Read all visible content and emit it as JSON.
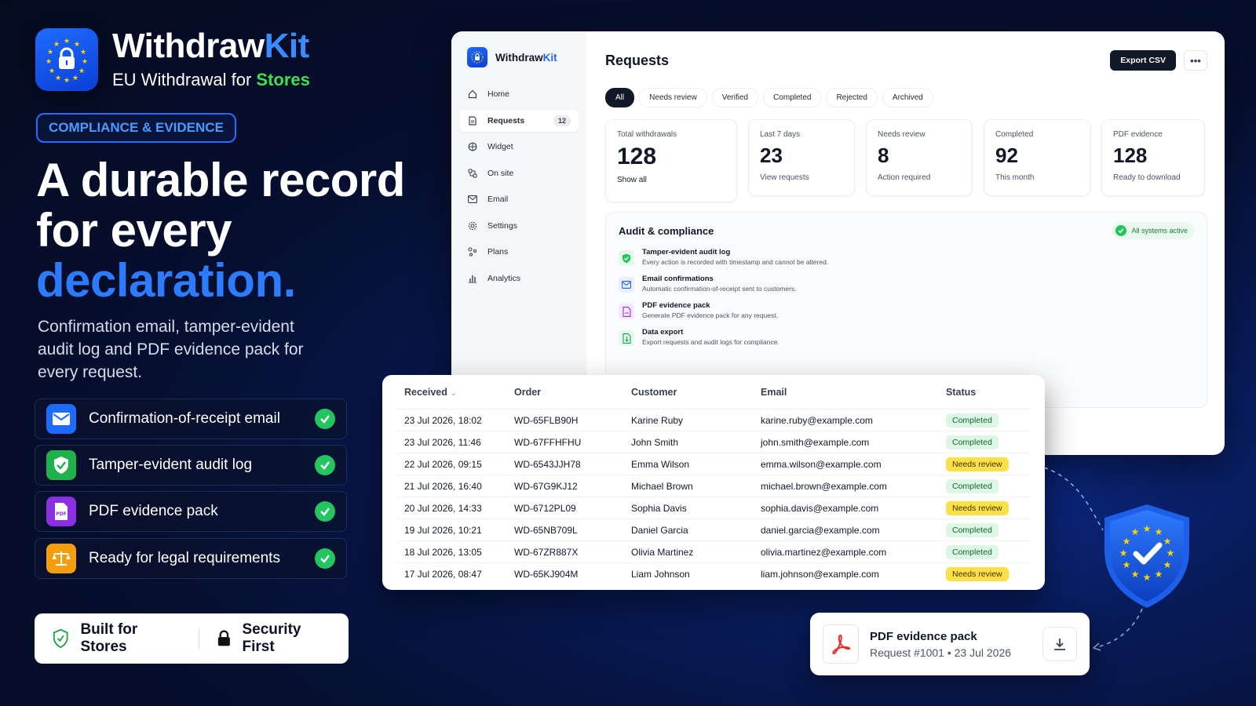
{
  "brand": {
    "name_main": "Withdraw",
    "name_accent": "Kit",
    "subtitle_main": "EU Withdrawal for ",
    "subtitle_accent": "Stores"
  },
  "marketing": {
    "badge": "COMPLIANCE & EVIDENCE",
    "headline_line1": "A durable record",
    "headline_line2": "for every",
    "headline_line3": "declaration.",
    "sub_copy": "Confirmation email, tamper-evident audit log and PDF evidence pack for every request.",
    "features": [
      {
        "label": "Confirmation-of-receipt email",
        "icon": "mail-icon"
      },
      {
        "label": "Tamper-evident audit log",
        "icon": "shield-check-icon"
      },
      {
        "label": "PDF evidence pack",
        "icon": "pdf-icon"
      },
      {
        "label": "Ready for legal requirements",
        "icon": "scale-icon"
      }
    ],
    "trust": [
      {
        "label": "Built for Stores",
        "icon": "shield-icon"
      },
      {
        "label": "Security First",
        "icon": "lock-icon"
      }
    ]
  },
  "app": {
    "brand_main": "Withdraw",
    "brand_accent": "Kit",
    "nav": [
      {
        "label": "Home",
        "icon": "home-icon"
      },
      {
        "label": "Requests",
        "icon": "document-icon",
        "count": "12",
        "active": true
      },
      {
        "label": "Widget",
        "icon": "widget-icon"
      },
      {
        "label": "On site",
        "icon": "onsite-icon"
      },
      {
        "label": "Email",
        "icon": "mail-icon"
      },
      {
        "label": "Settings",
        "icon": "gear-icon"
      },
      {
        "label": "Plans",
        "icon": "plans-icon"
      },
      {
        "label": "Analytics",
        "icon": "chart-icon"
      }
    ],
    "page_title": "Requests",
    "export_label": "Export CSV",
    "more_label": "•••",
    "tabs": [
      "All",
      "Needs review",
      "Verified",
      "Completed",
      "Rejected",
      "Archived"
    ],
    "stats": [
      {
        "label": "Total withdrawals",
        "value": "128",
        "foot": "Show all"
      },
      {
        "label": "Last 7 days",
        "value": "23",
        "foot": "View requests"
      },
      {
        "label": "Needs review",
        "value": "8",
        "foot": "Action required"
      },
      {
        "label": "Completed",
        "value": "92",
        "foot": "This month"
      },
      {
        "label": "PDF evidence",
        "value": "128",
        "foot": "Ready to download"
      }
    ],
    "audit": {
      "title": "Audit & compliance",
      "badge": "All systems active",
      "items": [
        {
          "title": "Tamper-evident audit log",
          "desc": "Every action is recorded with timestamp and cannot be altered.",
          "color": "#22c55e"
        },
        {
          "title": "Email confirmations",
          "desc": "Automatic confirmation-of-receipt sent to customers.",
          "color": "#2563eb"
        },
        {
          "title": "PDF evidence pack",
          "desc": "Generate PDF evidence pack for any request.",
          "color": "#9333ea"
        },
        {
          "title": "Data export",
          "desc": "Export requests and audit logs for compliance.",
          "color": "#16a34a"
        }
      ]
    }
  },
  "table": {
    "headers": [
      "Received",
      "Order",
      "Customer",
      "Email",
      "Status"
    ],
    "sort_indicator": "⌄",
    "rows": [
      [
        "23 Jul 2026, 18:02",
        "WD-65FLB90H",
        "Karine Ruby",
        "karine.ruby@example.com",
        "Completed"
      ],
      [
        "23 Jul 2026, 11:46",
        "WD-67FFHFHU",
        "John Smith",
        "john.smith@example.com",
        "Completed"
      ],
      [
        "22 Jul 2026, 09:15",
        "WD-6543JJH78",
        "Emma Wilson",
        "emma.wilson@example.com",
        "Needs review"
      ],
      [
        "21 Jul 2026, 16:40",
        "WD-67G9KJ12",
        "Michael Brown",
        "michael.brown@example.com",
        "Completed"
      ],
      [
        "20 Jul 2026, 14:33",
        "WD-6712PL09",
        "Sophia Davis",
        "sophia.davis@example.com",
        "Needs review"
      ],
      [
        "19 Jul 2026, 10:21",
        "WD-65NB709L",
        "Daniel Garcia",
        "daniel.garcia@example.com",
        "Completed"
      ],
      [
        "18 Jul 2026, 13:05",
        "WD-67ZR887X",
        "Olivia Martinez",
        "olivia.martinez@example.com",
        "Completed"
      ],
      [
        "17 Jul 2026, 08:47",
        "WD-65KJ904M",
        "Liam Johnson",
        "liam.johnson@example.com",
        "Needs review"
      ]
    ]
  },
  "pdf_card": {
    "title": "PDF evidence pack",
    "subtitle": "Request #1001 • 23 Jul 2026"
  },
  "colors": {
    "accent_blue": "#2d7bff",
    "accent_green": "#3ee052",
    "completed_bg": "#dcf7e3",
    "review_bg": "#fde047"
  }
}
